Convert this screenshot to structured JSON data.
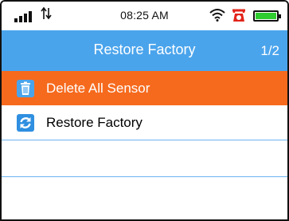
{
  "status_bar": {
    "time": "08:25 AM",
    "icons": [
      "signal-bars-icon",
      "data-arrows-icon",
      "wifi-icon",
      "alarm-icon",
      "battery-icon"
    ],
    "battery_level": 1.0
  },
  "header": {
    "title": "Restore Factory",
    "page_indicator": "1/2"
  },
  "menu": {
    "items": [
      {
        "label": "Delete All Sensor",
        "icon": "trash-icon",
        "selected": true
      },
      {
        "label": "Restore Factory",
        "icon": "refresh-icon",
        "selected": false
      }
    ]
  },
  "colors": {
    "header": "#4aa4ec",
    "selected": "#f66a1d",
    "divider": "#6cb4f0",
    "battery": "#2ecc2e",
    "alarm": "#e2231a"
  }
}
